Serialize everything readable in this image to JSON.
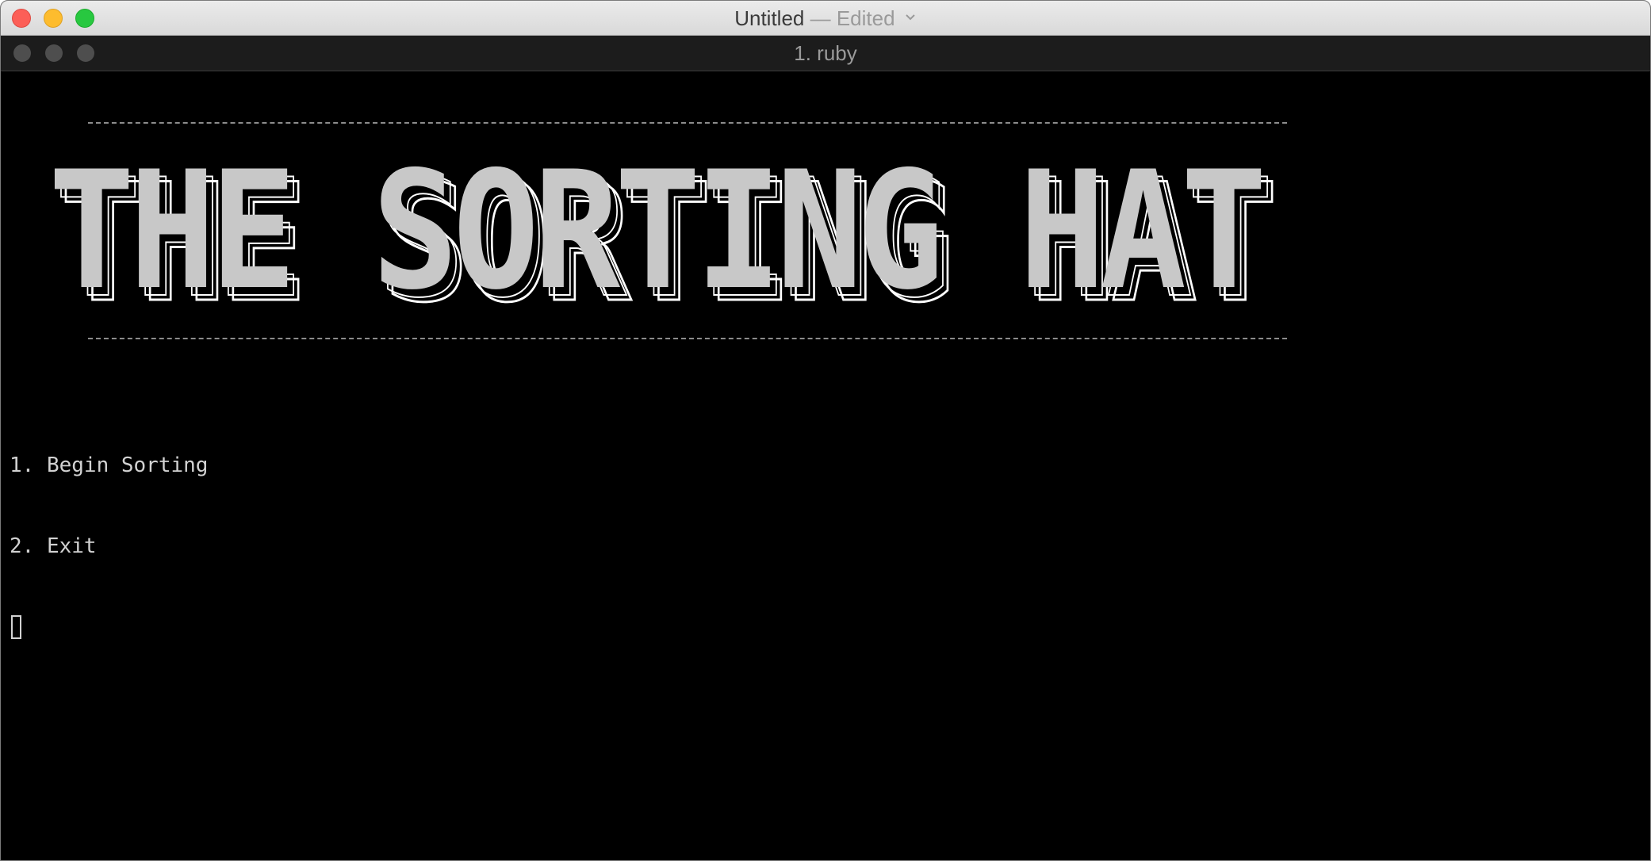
{
  "window": {
    "title": "Untitled",
    "title_separator": "—",
    "title_status": "Edited",
    "title_menu_icon": "chevron-down-icon"
  },
  "terminal_tab": {
    "title": "1. ruby"
  },
  "terminal": {
    "banner_text": "THE SORTING HAT",
    "banner_rule": "_____________________________________________________________________________________________________________________",
    "menu_items": [
      {
        "label": "1. Begin Sorting"
      },
      {
        "label": "2. Exit"
      }
    ],
    "cursor_icon": "block-cursor-icon"
  },
  "colors": {
    "terminal_bg": "#000000",
    "terminal_text": "#d2d2d2",
    "banner_fill": "#c8c8c8",
    "banner_outline": "#ffffff",
    "close": "#fc5f57",
    "minimize": "#fdbc2e",
    "maximize": "#28c840"
  }
}
